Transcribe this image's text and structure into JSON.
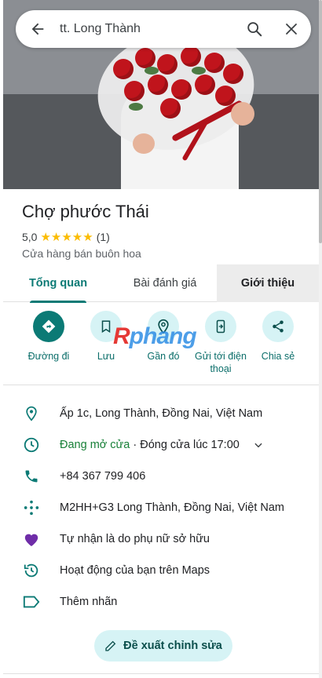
{
  "search": {
    "query": "tt. Long Thành"
  },
  "place": {
    "name": "Chợ phước Thái",
    "rating": "5,0",
    "stars": "★★★★★",
    "review_count": "(1)",
    "category": "Cửa hàng bán buôn hoa"
  },
  "tabs": [
    {
      "label": "Tổng quan"
    },
    {
      "label": "Bài đánh giá"
    },
    {
      "label": "Giới thiệu"
    }
  ],
  "actions": [
    {
      "label": "Đường đi",
      "icon": "directions-icon"
    },
    {
      "label": "Lưu",
      "icon": "bookmark-icon"
    },
    {
      "label": "Gần đó",
      "icon": "nearby-icon"
    },
    {
      "label": "Gửi tới điện thoại",
      "icon": "send-to-phone-icon"
    },
    {
      "label": "Chia sẻ",
      "icon": "share-icon"
    }
  ],
  "watermark": {
    "part1": "R",
    "part2": "phang"
  },
  "info": {
    "address": "Ấp 1c, Long Thành, Đồng Nai, Việt Nam",
    "hours_status": "Đang mở cửa",
    "hours_sep": " · ",
    "hours_close": "Đóng cửa lúc 17:00",
    "phone": "+84 367 799 406",
    "plus_code": "M2HH+G3 Long Thành, Đồng Nai, Việt Nam",
    "women_owned": "Tự nhận là do phụ nữ sở hữu",
    "activity": "Hoạt động của bạn trên Maps",
    "add_label": "Thêm nhãn"
  },
  "suggest_edit": "Đề xuất chỉnh sửa",
  "colors": {
    "accent": "#0b7a75",
    "open": "#188038",
    "star": "#fbbc04",
    "chip": "#d6f3f5",
    "heart": "#6f2da8"
  }
}
